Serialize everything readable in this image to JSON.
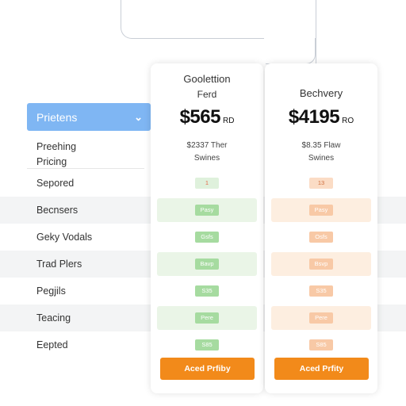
{
  "filter": {
    "label": "Prietens"
  },
  "features": {
    "header_line1": "Preehing",
    "header_line2": "Pricing",
    "rows": [
      "Sepored",
      "Becnsers",
      "Geky Vodals",
      "Trad Plers",
      "Pegjils",
      "Teacing",
      "Eepted"
    ]
  },
  "plans": [
    {
      "name": "Goolettion",
      "subtitle": "Ferd",
      "price": "$565",
      "price_unit": "RD",
      "desc_line1": "$2337 Ther",
      "desc_line2": "Swines",
      "cells": [
        "1",
        "Pasy",
        "Gsfs",
        "Bavp",
        "S35",
        "Pere",
        "S85"
      ],
      "cta": "Aced Prfiby"
    },
    {
      "name": "Bechvery",
      "subtitle": "",
      "price": "$4195",
      "price_unit": "RO",
      "desc_line1": "$8.35 Flaw",
      "desc_line2": "Swines",
      "cells": [
        "13",
        "Pasy",
        "Osfs",
        "Bsvp",
        "S35",
        "Pere",
        "S85"
      ],
      "cta": "Aced Prfity"
    }
  ],
  "colors": {
    "dropdown": "#7fb6f3",
    "cta": "#f28a1a",
    "left_tint": "#eaf5e7",
    "right_tint": "#fdeee0"
  }
}
